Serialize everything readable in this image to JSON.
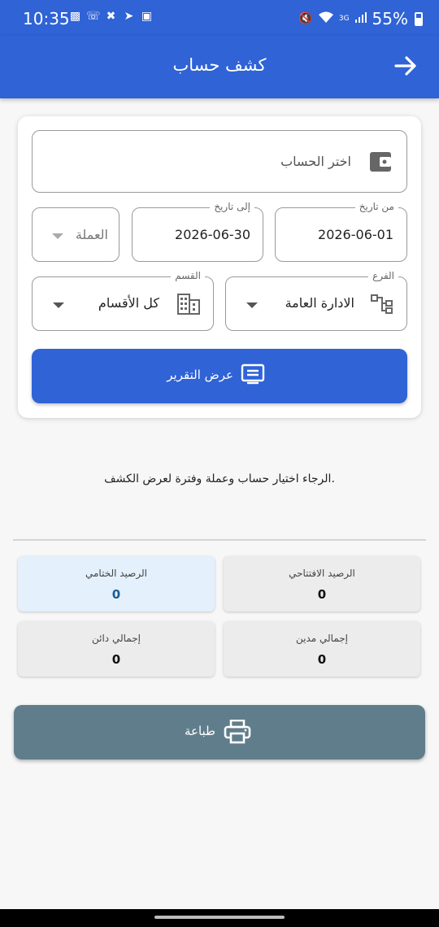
{
  "status_bar": {
    "time": "10:35",
    "network": "3G",
    "battery": "55%",
    "notification_icons": [
      "message-icon",
      "whatsapp-icon",
      "missed-call-icon",
      "telegram-icon",
      "gallery-icon"
    ]
  },
  "app_bar": {
    "title": "كشف حساب",
    "back_icon": "arrow-right-icon"
  },
  "form": {
    "account_placeholder": "اختر الحساب",
    "from_date_label": "من تاريخ",
    "from_date_value": "2026-06-01",
    "to_date_label": "إلى تاريخ",
    "to_date_value": "2026-06-30",
    "currency_placeholder": "العملة",
    "branch_label": "الفرع",
    "branch_value": "الادارة العامة",
    "department_label": "القسم",
    "department_value": "كل الأقسام",
    "show_report_label": "عرض التقرير"
  },
  "hint": "الرجاء اختيار حساب وعملة وفترة لعرض الكشف.",
  "summary": {
    "opening_label": "الرصيد الافتتاحي",
    "opening_value": "0",
    "closing_label": "الرصيد الختامي",
    "closing_value": "0",
    "debit_label": "إجمالي مدين",
    "debit_value": "0",
    "credit_label": "إجمالي دائن",
    "credit_value": "0"
  },
  "print_label": "طباعة",
  "colors": {
    "primary": "#2f63d6",
    "print_button": "#607d8b",
    "closing_card_bg": "#e4f0fb",
    "closing_value": "#1b5b93"
  }
}
